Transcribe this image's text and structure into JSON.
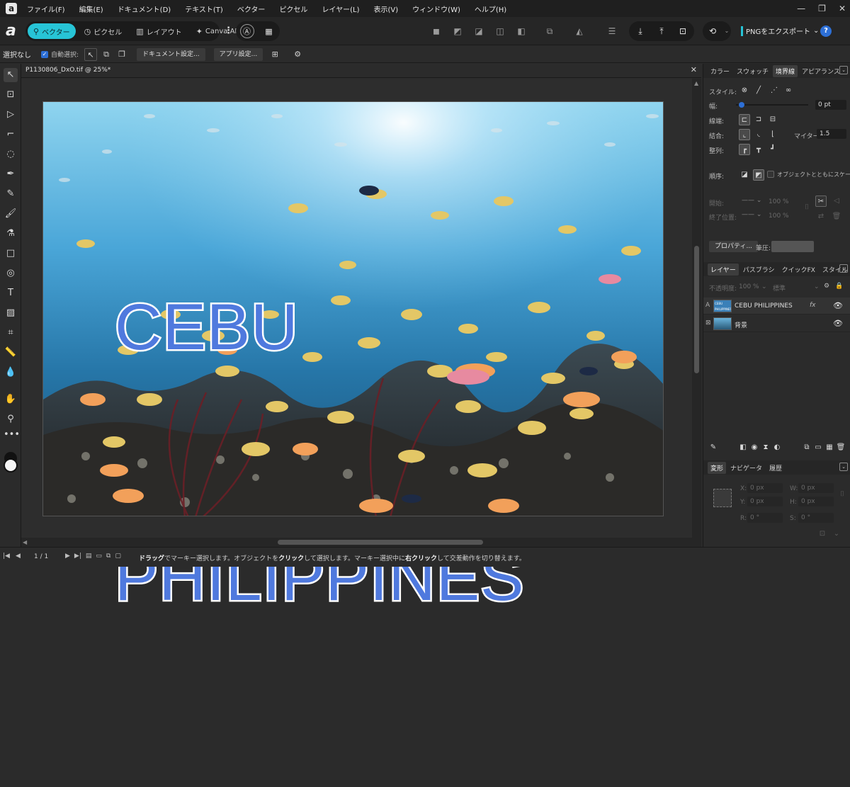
{
  "menubar": {
    "items": [
      "ファイル(F)",
      "編集(E)",
      "ドキュメント(D)",
      "テキスト(T)",
      "ベクター",
      "ピクセル",
      "レイヤー(L)",
      "表示(V)",
      "ウィンドウ(W)",
      "ヘルプ(H)"
    ]
  },
  "toolbar": {
    "personas": [
      "ベクター",
      "ピクセル",
      "レイアウト",
      "Canva AI"
    ],
    "export_label": "PNGをエクスポート",
    "help_label": "?"
  },
  "context": {
    "selection_label": "選択なし",
    "auto_select_label": "自動選択:",
    "doc_settings_label": "ドキュメント設定...",
    "app_settings_label": "アプリ設定..."
  },
  "document": {
    "tab_title": "P1130806_DxO.tif @ 25%*",
    "artwork_line1": "CEBU",
    "artwork_line2": "PHILIPPINES"
  },
  "stroke_panel": {
    "tabs": [
      "カラー",
      "スウォッチ",
      "境界線",
      "アピアランス"
    ],
    "style_label": "スタイル:",
    "width_label": "幅:",
    "width_value": "0 pt",
    "width_fraction": 0.0,
    "cap_label": "線端:",
    "join_label": "結合:",
    "miter_label": "マイター:",
    "miter_value": "1.5",
    "align_label": "整列:",
    "order_label": "順序:",
    "scale_label": "オブジェクトとともにスケーリング",
    "start_label": "開始:",
    "end_label": "終了位置:",
    "start_pct": "100 %",
    "end_pct": "100 %",
    "properties_label": "プロパティ...",
    "pressure_label": "筆圧:"
  },
  "layers_panel": {
    "tabs": [
      "レイヤー",
      "パスブラシ",
      "クイックFX",
      "スタイル"
    ],
    "opacity_label": "不透明度:",
    "opacity_value": "100 %",
    "blend_value": "標準",
    "layers": [
      {
        "name": "CEBU PHILIPPINES",
        "thumb_text": "CEBU PHILIPPINES",
        "type_icon": "A",
        "fx": "fx"
      },
      {
        "name": "背景",
        "type_icon": "⊠"
      }
    ]
  },
  "transform_panel": {
    "tabs": [
      "変形",
      "ナビゲータ",
      "履歴"
    ],
    "x_label": "X:",
    "x_value": "0 px",
    "y_label": "Y:",
    "y_value": "0 px",
    "w_label": "W:",
    "w_value": "0 px",
    "h_label": "H:",
    "h_value": "0 px",
    "r_label": "R:",
    "r_value": "0 °",
    "s_label": "S:",
    "s_value": "0 °"
  },
  "status": {
    "page_count": "1 / 1",
    "hint_parts": [
      "ドラッグ",
      "でマーキー選択します。オブジェクトを",
      "クリック",
      "して選択します。マーキー選択中に",
      "右クリック",
      "して交差動作を切り替えます。"
    ]
  },
  "colors": {
    "accent": "#27c4d6",
    "artwork_text": "#4f79de",
    "artwork_stroke": "#ffffff",
    "help": "#2d6fd6"
  }
}
